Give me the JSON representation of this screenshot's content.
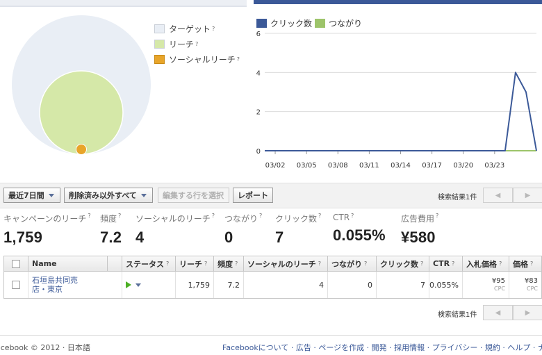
{
  "reach_legend": [
    {
      "label": "ターゲット",
      "color": "#e9eef5"
    },
    {
      "label": "リーチ",
      "color": "#d5e8a8"
    },
    {
      "label": "ソーシャルリーチ",
      "color": "#e8a52a"
    }
  ],
  "help_mark": "?",
  "chart_data": {
    "type": "line",
    "series": [
      {
        "name": "クリック数",
        "color": "#3b5998",
        "values": [
          0,
          0,
          0,
          0,
          0,
          0,
          0,
          0,
          0,
          0,
          0,
          0,
          0,
          0,
          0,
          0,
          0,
          0,
          0,
          0,
          0,
          0,
          0,
          0,
          4,
          3,
          0
        ]
      },
      {
        "name": "つながり",
        "color": "#9dc46a",
        "values": [
          0,
          0,
          0,
          0,
          0,
          0,
          0,
          0,
          0,
          0,
          0,
          0,
          0,
          0,
          0,
          0,
          0,
          0,
          0,
          0,
          0,
          0,
          0,
          0,
          0,
          0,
          0
        ]
      }
    ],
    "x_ticks": [
      "03/02",
      "03/05",
      "03/08",
      "03/11",
      "03/14",
      "03/17",
      "03/20",
      "03/23"
    ],
    "y_ticks": [
      "0",
      "2",
      "4",
      "6"
    ],
    "ylim": [
      0,
      6
    ]
  },
  "toolbar": {
    "date_range": "最近7日間",
    "filter": "削除済み以外すべて",
    "edit_selected": "編集する行を選択",
    "report": "レポート",
    "results_count": "検索結果1件",
    "prev": "◀",
    "next": "▶"
  },
  "stats": [
    {
      "label": "キャンペーンのリーチ",
      "value": "1,759"
    },
    {
      "label": "頻度",
      "value": "7.2"
    },
    {
      "label": "ソーシャルのリーチ",
      "value": "4"
    },
    {
      "label": "つながり",
      "value": "0"
    },
    {
      "label": "クリック数",
      "value": "7"
    },
    {
      "label": "CTR",
      "value": "0.055%"
    },
    {
      "label": "広告費用",
      "value": "¥580"
    }
  ],
  "table": {
    "headers": {
      "name": "Name",
      "status": "ステータス",
      "reach": "リーチ",
      "frequency": "頻度",
      "social_reach": "ソーシャルのリーチ",
      "connections": "つながり",
      "clicks": "クリック数",
      "ctr": "CTR",
      "bid": "入札価格",
      "price": "価格"
    },
    "rows": [
      {
        "name_line1": "石垣島共同売",
        "name_line2": "店・東京",
        "reach": "1,759",
        "frequency": "7.2",
        "social_reach": "4",
        "connections": "0",
        "clicks": "7",
        "ctr": "0.055%",
        "bid": "¥95",
        "bid_unit": "CPC",
        "price": "¥83",
        "price_unit": "CPC"
      }
    ]
  },
  "bottom_results_count": "検索結果1件",
  "footer": {
    "left": "acebook © 2012 · 日本語",
    "right": "Facebookについて · 広告 · ページを作成 · 開発 · 採用情報 · プライバシー · 規約 · ヘルプ · ナ"
  }
}
